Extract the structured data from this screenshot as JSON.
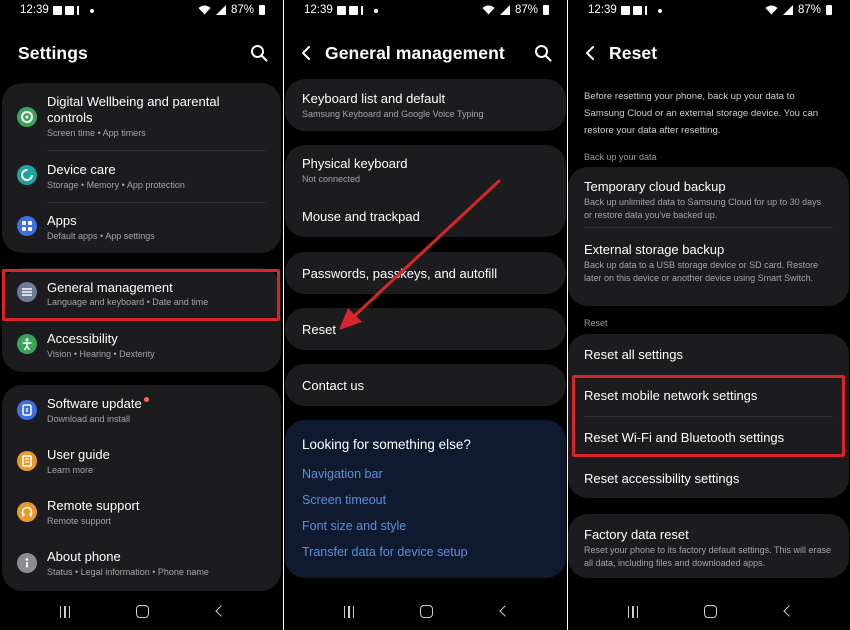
{
  "status_bar": {
    "time": "12:39",
    "battery": "87%"
  },
  "panel_settings": {
    "title": "Settings",
    "items": [
      {
        "label": "Digital Wellbeing and parental controls",
        "sub": "Screen time  •  App timers",
        "icon": "digital-wellbeing-icon",
        "color": "#3aa35a"
      },
      {
        "label": "Device care",
        "sub": "Storage  •  Memory  •  App protection",
        "icon": "device-care-icon",
        "color": "#1fa2a0"
      },
      {
        "label": "Apps",
        "sub": "Default apps  •  App settings",
        "icon": "apps-icon",
        "color": "#3f6fe0"
      },
      {
        "label": "General management",
        "sub": "Language and keyboard  •  Date and time",
        "icon": "general-management-icon",
        "color": "#6b7c97"
      },
      {
        "label": "Accessibility",
        "sub": "Vision  •  Hearing  •  Dexterity",
        "icon": "accessibility-icon",
        "color": "#3aa35a"
      },
      {
        "label": "Software update",
        "sub": "Download and install",
        "icon": "software-update-icon",
        "color": "#3f6fe0"
      },
      {
        "label": "User guide",
        "sub": "Learn more",
        "icon": "user-guide-icon",
        "color": "#e89a2b"
      },
      {
        "label": "Remote support",
        "sub": "Remote support",
        "icon": "remote-support-icon",
        "color": "#e89a2b"
      },
      {
        "label": "About phone",
        "sub": "Status  •  Legal information  •  Phone name",
        "icon": "about-phone-icon",
        "color": "#8c8c92"
      }
    ]
  },
  "panel_general": {
    "title": "General management",
    "items": [
      {
        "label": "Keyboard list and default",
        "sub": "Samsung Keyboard and Google Voice Typing"
      },
      {
        "label": "Physical keyboard",
        "sub": "Not connected"
      },
      {
        "label": "Mouse and trackpad"
      },
      {
        "label": "Passwords, passkeys, and autofill"
      },
      {
        "label": "Reset"
      },
      {
        "label": "Contact us"
      }
    ],
    "suggestions": {
      "heading": "Looking for something else?",
      "links": [
        "Navigation bar",
        "Screen timeout",
        "Font size and style",
        "Transfer data for device setup"
      ]
    }
  },
  "panel_reset": {
    "title": "Reset",
    "intro": "Before resetting your phone, back up your data to Samsung Cloud or an external storage device. You can restore your data after resetting.",
    "backup_section": "Back up your data",
    "backup_items": [
      {
        "label": "Temporary cloud backup",
        "sub": "Back up unlimited data to Samsung Cloud for up to 30 days or restore data you've backed up."
      },
      {
        "label": "External storage backup",
        "sub": "Back up data to a USB storage device or SD card. Restore later on this device or another device using Smart Switch."
      }
    ],
    "reset_section": "Reset",
    "reset_items": [
      "Reset all settings",
      "Reset mobile network settings",
      "Reset Wi-Fi and Bluetooth settings",
      "Reset accessibility settings"
    ],
    "factory": {
      "label": "Factory data reset",
      "sub": "Reset your phone to its factory default settings. This will erase all data, including files and downloaded apps."
    }
  },
  "colors": {
    "highlight": "#d6262c",
    "arrow": "#d6262c",
    "card": "#1c1c1e",
    "link": "#5b8fd6"
  }
}
